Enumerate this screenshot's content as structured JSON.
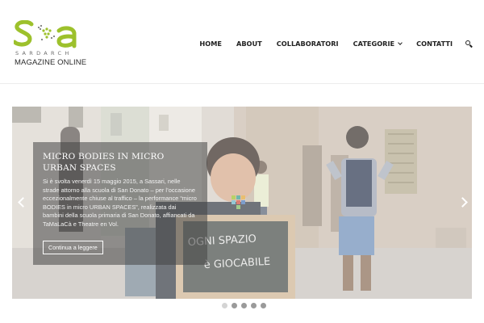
{
  "brand": {
    "name": "SARDARCH",
    "tagline": "MAGAZINE ONLINE",
    "colors": {
      "green": "#9dc12c",
      "grey": "#7d7d7d"
    }
  },
  "nav": {
    "items": [
      {
        "label": "HOME"
      },
      {
        "label": "ABOUT"
      },
      {
        "label": "COLLABORATORI"
      },
      {
        "label": "CATEGORIE",
        "icon": "chevron-down-icon"
      },
      {
        "label": "CONTATTI"
      }
    ],
    "search_icon": "search-icon"
  },
  "slider": {
    "prev_icon": "chevron-left-icon",
    "next_icon": "chevron-right-icon",
    "slide": {
      "title": "MICRO BODIES IN MICRO URBAN SPACES",
      "excerpt": "Si è svolta venerdì 15 maggio 2015, a Sassari, nelle strade attorno alla scuola di San Donato – per l’occasione eccezionalmente chiuse al traffico – la performance “micro BODIES in micro URBAN SPACES”, realizzata dai bambini della scuola primaria di San Donato, affiancati da TaMaLaCà e Theatre en Vol.",
      "button_label": "Continua a leggere",
      "chalkboard_text": [
        "OGNI SPAZIO",
        "è GIOCABILE"
      ]
    },
    "dots": {
      "count": 5,
      "active_index": 0
    }
  }
}
